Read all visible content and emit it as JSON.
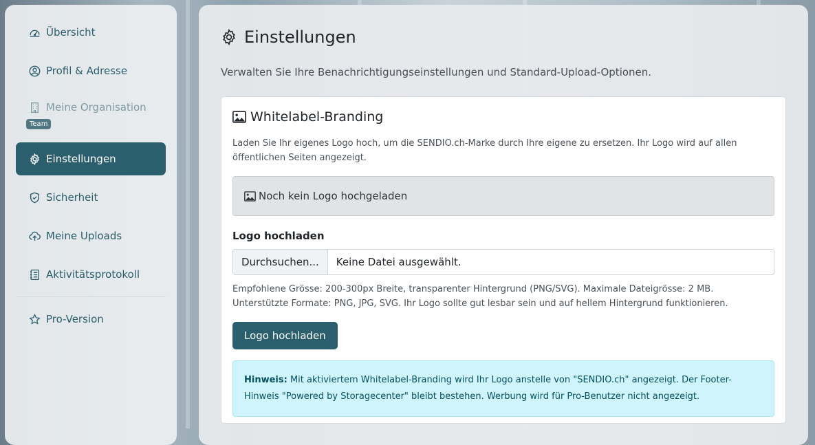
{
  "sidebar": {
    "items": [
      {
        "label": "Übersicht",
        "icon": "dashboard-icon"
      },
      {
        "label": "Profil & Adresse",
        "icon": "user-circle-icon"
      },
      {
        "label": "Meine Organisation",
        "icon": "building-icon",
        "badge": "Team",
        "disabled": true
      },
      {
        "label": "Einstellungen",
        "icon": "gear-icon",
        "active": true
      },
      {
        "label": "Sicherheit",
        "icon": "shield-check-icon"
      },
      {
        "label": "Meine Uploads",
        "icon": "cloud-upload-icon"
      },
      {
        "label": "Aktivitätsprotokoll",
        "icon": "journal-list-icon"
      },
      {
        "label": "Pro-Version",
        "icon": "star-icon"
      }
    ]
  },
  "main": {
    "title": "Einstellungen",
    "description": "Verwalten Sie Ihre Benachrichtigungseinstellungen und Standard-Upload-Optionen.",
    "card": {
      "title": "Whitelabel-Branding",
      "description": "Laden Sie Ihr eigenes Logo hoch, um die SENDIO.ch-Marke durch Ihre eigene zu ersetzen. Ihr Logo wird auf allen öffentlichen Seiten angezeigt.",
      "placeholder": "Noch kein Logo hochgeladen",
      "upload_label": "Logo hochladen",
      "browse_label": "Durchsuchen...",
      "file_status": "Keine Datei ausgewählt.",
      "help_line1": "Empfohlene Grösse: 200-300px Breite, transparenter Hintergrund (PNG/SVG). Maximale Dateigrösse: 2 MB.",
      "help_line2": "Unterstützte Formate: PNG, JPG, SVG. Ihr Logo sollte gut lesbar sein und auf hellem Hintergrund funktionieren.",
      "upload_button": "Logo hochladen",
      "alert_label": "Hinweis:",
      "alert_text": " Mit aktiviertem Whitelabel-Branding wird Ihr Logo anstelle von \"SENDIO.ch\" angezeigt. Der Footer-Hinweis \"Powered by Storagecenter\" bleibt bestehen. Werbung wird für Pro-Benutzer nicht angezeigt."
    }
  },
  "colors": {
    "primary": "#2b5f6e",
    "nav_text": "#2a5d6b",
    "alert_bg": "#cff4fc",
    "alert_text": "#055160"
  }
}
